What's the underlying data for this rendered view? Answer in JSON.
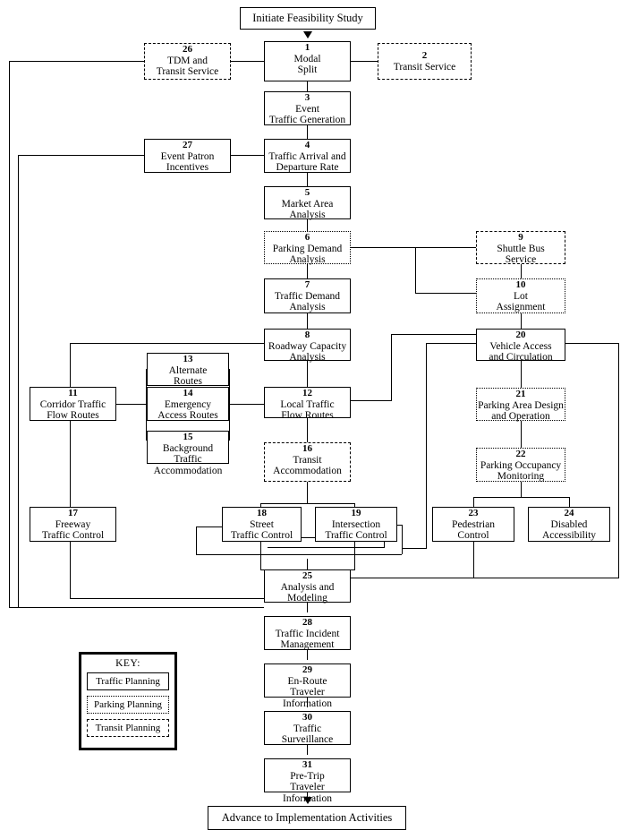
{
  "diagram": {
    "title_start": "Initiate Feasibility Study",
    "title_end": "Advance to Implementation Activities",
    "legend": {
      "title": "KEY:",
      "items": [
        {
          "label": "Traffic Planning",
          "style": "solid"
        },
        {
          "label": "Parking Planning",
          "style": "dotted"
        },
        {
          "label": "Transit Planning",
          "style": "dash-dot"
        }
      ]
    },
    "nodes": [
      {
        "num": "1",
        "label": "Modal\nSplit",
        "category": "traffic"
      },
      {
        "num": "2",
        "label": "Transit Service",
        "category": "transit"
      },
      {
        "num": "3",
        "label": "Event\nTraffic Generation",
        "category": "traffic"
      },
      {
        "num": "4",
        "label": "Traffic Arrival and\nDeparture Rate",
        "category": "traffic"
      },
      {
        "num": "5",
        "label": "Market Area\nAnalysis",
        "category": "traffic"
      },
      {
        "num": "6",
        "label": "Parking Demand\nAnalysis",
        "category": "parking"
      },
      {
        "num": "7",
        "label": "Traffic Demand\nAnalysis",
        "category": "traffic"
      },
      {
        "num": "8",
        "label": "Roadway Capacity\nAnalysis",
        "category": "traffic"
      },
      {
        "num": "9",
        "label": "Shuttle Bus\nService",
        "category": "transit"
      },
      {
        "num": "10",
        "label": "Lot\nAssignment",
        "category": "parking"
      },
      {
        "num": "11",
        "label": "Corridor Traffic\nFlow Routes",
        "category": "traffic"
      },
      {
        "num": "12",
        "label": "Local Traffic\nFlow Routes",
        "category": "traffic"
      },
      {
        "num": "13",
        "label": "Alternate\nRoutes",
        "category": "traffic"
      },
      {
        "num": "14",
        "label": "Emergency\nAccess Routes",
        "category": "traffic"
      },
      {
        "num": "15",
        "label": "Background  Traffic\nAccommodation",
        "category": "traffic"
      },
      {
        "num": "16",
        "label": "Transit\nAccommodation",
        "category": "transit"
      },
      {
        "num": "17",
        "label": "Freeway\nTraffic Control",
        "category": "traffic"
      },
      {
        "num": "18",
        "label": "Street\nTraffic Control",
        "category": "traffic"
      },
      {
        "num": "19",
        "label": "Intersection\nTraffic Control",
        "category": "traffic"
      },
      {
        "num": "20",
        "label": "Vehicle Access\nand Circulation",
        "category": "traffic"
      },
      {
        "num": "21",
        "label": "Parking Area Design\nand Operation",
        "category": "parking"
      },
      {
        "num": "22",
        "label": "Parking Occupancy\nMonitoring",
        "category": "parking"
      },
      {
        "num": "23",
        "label": "Pedestrian\nControl",
        "category": "traffic"
      },
      {
        "num": "24",
        "label": "Disabled\nAccessibility",
        "category": "traffic"
      },
      {
        "num": "25",
        "label": "Analysis and\nModeling",
        "category": "traffic"
      },
      {
        "num": "26",
        "label": "TDM and\nTransit Service",
        "category": "transit"
      },
      {
        "num": "27",
        "label": "Event Patron\nIncentives",
        "category": "traffic"
      },
      {
        "num": "28",
        "label": "Traffic Incident\nManagement",
        "category": "traffic"
      },
      {
        "num": "29",
        "label": "En-Route\nTraveler Information",
        "category": "traffic"
      },
      {
        "num": "30",
        "label": "Traffic\nSurveillance",
        "category": "traffic"
      },
      {
        "num": "31",
        "label": "Pre-Trip\nTraveler Information",
        "category": "traffic"
      }
    ]
  }
}
